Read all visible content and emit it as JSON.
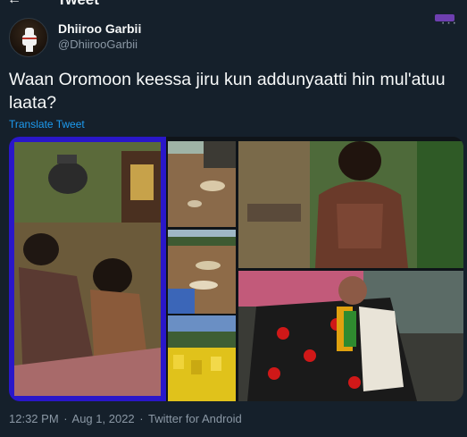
{
  "topbar": {
    "title": "Tweet"
  },
  "author": {
    "name": "Dhiiroo Garbii",
    "handle": "@DhiirooGarbii"
  },
  "more_icon": "more-horizontal-icon",
  "tweet": {
    "text": "Waan Oromoon keessa jiru kun addunyaatti hin mul'atuu laata?",
    "translate_label": "Translate Tweet"
  },
  "media": {
    "photo_count": 6,
    "highlight_color": "#2a17c9"
  },
  "footer": {
    "time": "12:32 PM",
    "separator1": "·",
    "date": "Aug 1, 2022",
    "separator2": "·",
    "source": "Twitter for Android"
  },
  "colors": {
    "background": "#15202b",
    "text": "#f7f9f9",
    "secondary": "#8b98a5",
    "link": "#1d9bf0"
  }
}
